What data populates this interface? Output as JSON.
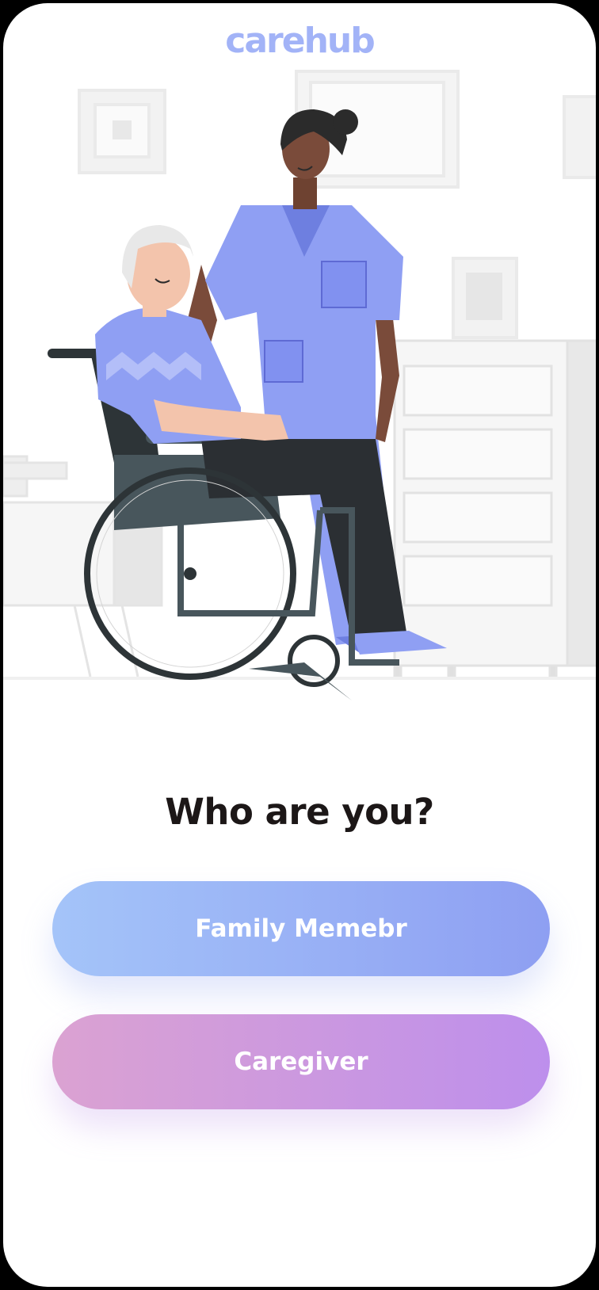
{
  "app": {
    "logo": "carehub"
  },
  "illustration": {
    "subject": "nurse-with-wheelchair-user"
  },
  "main": {
    "heading": "Who are you?",
    "buttons": [
      {
        "label": "Family Memebr"
      },
      {
        "label": "Caregiver"
      }
    ]
  },
  "colors": {
    "brand": "#a2b3f7",
    "family_gradient": [
      "#a4c4f9",
      "#8e9ff2"
    ],
    "caregiver_gradient": [
      "#dba2d2",
      "#bd8fec"
    ],
    "heading": "#1c1717",
    "scrubs": "#8f9ff3"
  }
}
